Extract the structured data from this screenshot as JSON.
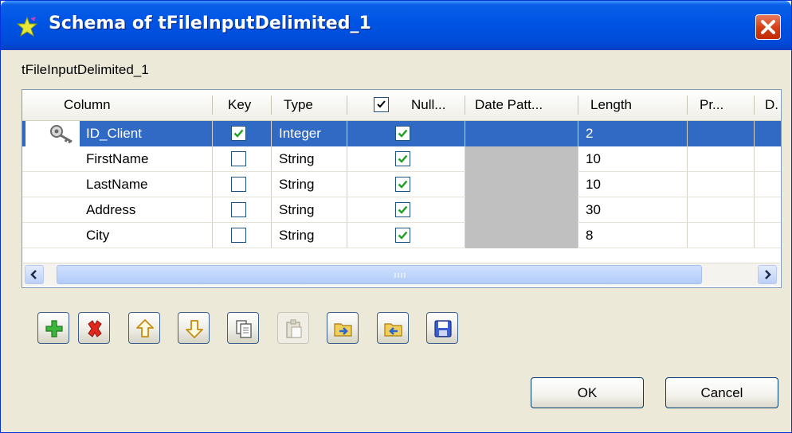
{
  "window": {
    "title": "Schema of tFileInputDelimited_1",
    "subtitle": "tFileInputDelimited_1"
  },
  "icons": {
    "title": "star-icon",
    "close": "close-x-icon",
    "key": "key-icon"
  },
  "colors": {
    "titlebar": "#0055e5",
    "selection": "#316ac5",
    "check": "#21a121",
    "close": "#d43d12",
    "gray_cell": "#c0c0c0"
  },
  "table": {
    "headers": {
      "column": "Column",
      "key": "Key",
      "type": "Type",
      "nullable": "Null...",
      "date_pattern": "Date Patt...",
      "length": "Length",
      "precision": "Pr...",
      "default": "D."
    },
    "header_nullable_checked": true,
    "rows": [
      {
        "column": "ID_Client",
        "key": true,
        "type": "Integer",
        "nullable": true,
        "length": "2",
        "selected": true,
        "key_icon": true
      },
      {
        "column": "FirstName",
        "key": false,
        "type": "String",
        "nullable": true,
        "length": "10",
        "selected": false,
        "key_icon": false
      },
      {
        "column": "LastName",
        "key": false,
        "type": "String",
        "nullable": true,
        "length": "10",
        "selected": false,
        "key_icon": false
      },
      {
        "column": "Address",
        "key": false,
        "type": "String",
        "nullable": true,
        "length": "30",
        "selected": false,
        "key_icon": false
      },
      {
        "column": "City",
        "key": false,
        "type": "String",
        "nullable": true,
        "length": "8",
        "selected": false,
        "key_icon": false
      }
    ]
  },
  "toolbar": {
    "buttons": [
      {
        "name": "add-row-button",
        "icon": "plus-icon",
        "enabled": true
      },
      {
        "name": "delete-row-button",
        "icon": "delete-x-icon",
        "enabled": true
      },
      {
        "name": "move-up-button",
        "icon": "arrow-up-icon",
        "enabled": true
      },
      {
        "name": "move-down-button",
        "icon": "arrow-down-icon",
        "enabled": true
      },
      {
        "name": "copy-button",
        "icon": "copy-icon",
        "enabled": true
      },
      {
        "name": "paste-button",
        "icon": "paste-icon",
        "enabled": false
      },
      {
        "name": "import-schema-button",
        "icon": "import-folder-icon",
        "enabled": true
      },
      {
        "name": "export-schema-button",
        "icon": "export-folder-icon",
        "enabled": true
      },
      {
        "name": "save-schema-button",
        "icon": "save-disk-icon",
        "enabled": true
      }
    ]
  },
  "buttons": {
    "ok": "OK",
    "cancel": "Cancel"
  }
}
